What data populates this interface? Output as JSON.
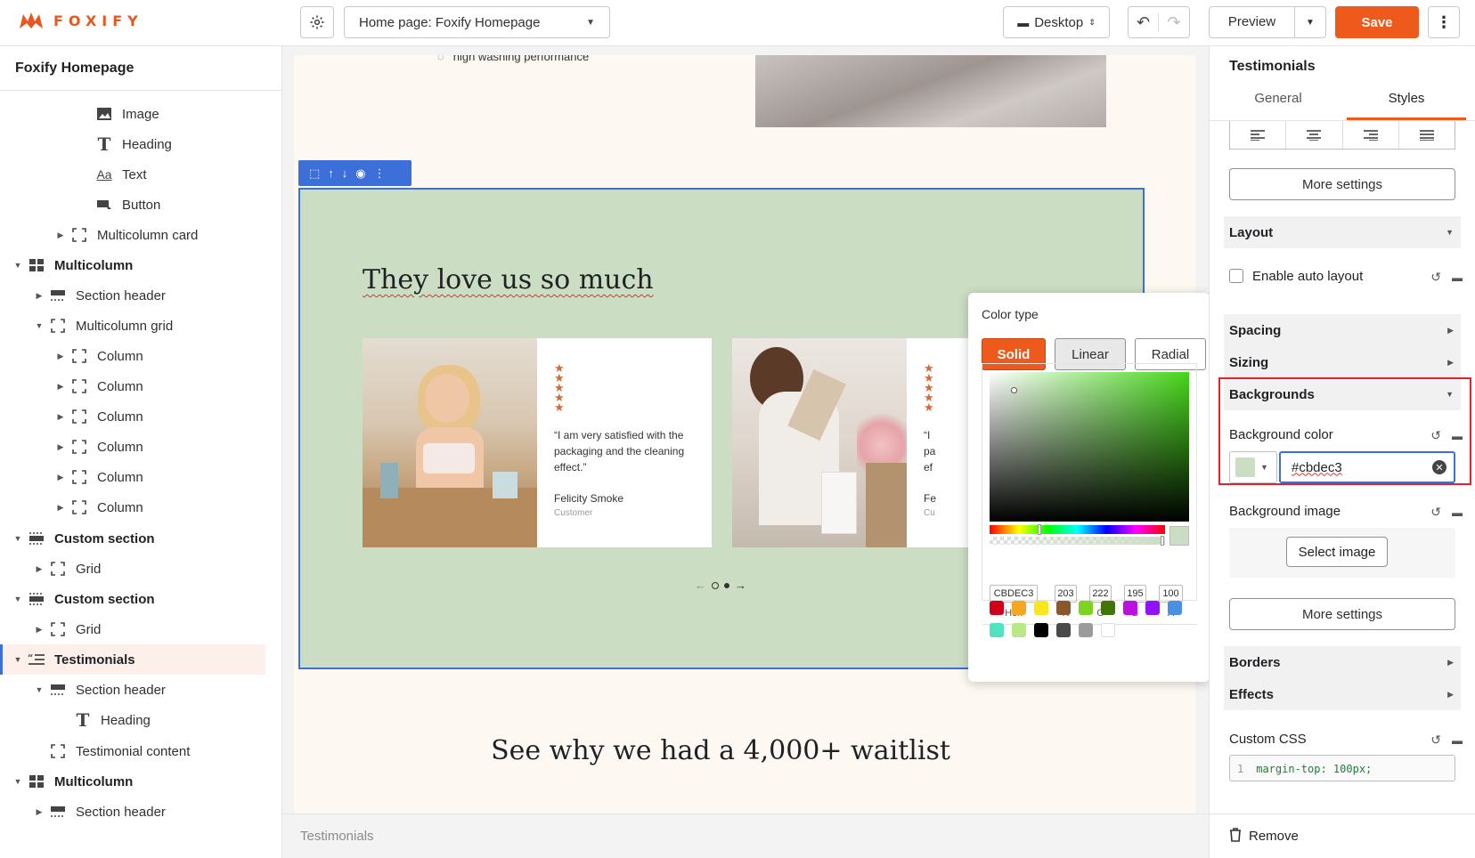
{
  "brand": {
    "logo_text": "FOXIFY",
    "accent": "#ee5a1c"
  },
  "topbar": {
    "page_select": "Home page: Foxify Homepage",
    "device": "Desktop",
    "preview": "Preview",
    "save": "Save"
  },
  "left": {
    "title": "Foxify Homepage",
    "items": [
      {
        "label": "Image"
      },
      {
        "label": "Heading"
      },
      {
        "label": "Text"
      },
      {
        "label": "Button"
      },
      {
        "label": "Multicolumn card"
      },
      {
        "label": "Multicolumn"
      },
      {
        "label": "Section header"
      },
      {
        "label": "Multicolumn grid"
      },
      {
        "label": "Column"
      },
      {
        "label": "Column"
      },
      {
        "label": "Column"
      },
      {
        "label": "Column"
      },
      {
        "label": "Column"
      },
      {
        "label": "Column"
      },
      {
        "label": "Custom section"
      },
      {
        "label": "Grid"
      },
      {
        "label": "Custom section"
      },
      {
        "label": "Grid"
      },
      {
        "label": "Testimonials"
      },
      {
        "label": "Section header"
      },
      {
        "label": "Heading"
      },
      {
        "label": "Testimonial content"
      },
      {
        "label": "Multicolumn"
      },
      {
        "label": "Section header"
      }
    ]
  },
  "canvas": {
    "top_text": "high washing performance",
    "section_heading": "They love us so much",
    "section_bg": "#cbdec3",
    "testimonial_1": {
      "quote": "“I am very satisfied with the packaging and the cleaning effect.”",
      "name": "Felicity Smoke",
      "role": "Customer"
    },
    "testimonial_2_fragments": [
      "“I",
      "pa",
      "ef",
      "Fe",
      "Cu"
    ],
    "bottom_heading": "See why we had a 4,000+ waitlist",
    "footer_label": "Testimonials"
  },
  "picker": {
    "title": "Color type",
    "types": [
      "Solid",
      "Linear",
      "Radial"
    ],
    "hex": "CBDEC3",
    "r": "203",
    "g": "222",
    "b": "195",
    "a": "100",
    "labels": [
      "Hex",
      "R",
      "G",
      "B",
      "A"
    ],
    "swatches_row1": [
      "#d0021b",
      "#f5a623",
      "#f8e71c",
      "#8b572a",
      "#7ed321",
      "#417505",
      "#bd10e0",
      "#9013fe",
      "#4a90e2"
    ],
    "swatches_row2": [
      "#50e3c2",
      "#b8e986",
      "#000000",
      "#4a4a4a",
      "#9b9b9b",
      "#ffffff"
    ]
  },
  "right": {
    "title": "Testimonials",
    "tabs": [
      "General",
      "Styles"
    ],
    "more_settings": "More settings",
    "layout": "Layout",
    "enable_auto_layout": "Enable auto layout",
    "spacing": "Spacing",
    "sizing": "Sizing",
    "backgrounds": "Backgrounds",
    "background_color_label": "Background color",
    "background_color_value": "#cbdec3",
    "background_image_label": "Background image",
    "select_image": "Select image",
    "borders": "Borders",
    "effects": "Effects",
    "custom_css": "Custom CSS",
    "css_line_no": "1",
    "css_code": "margin-top: 100px;",
    "remove": "Remove"
  }
}
